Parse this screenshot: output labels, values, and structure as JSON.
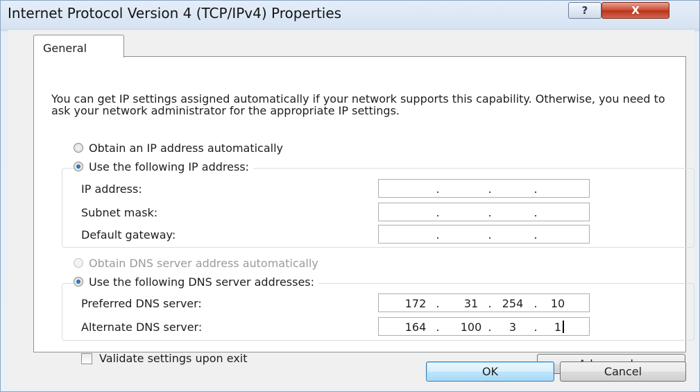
{
  "window": {
    "title": "Internet Protocol Version 4 (TCP/IPv4) Properties",
    "help_icon": "?",
    "close_icon": "X"
  },
  "tabs": [
    {
      "label": "General"
    }
  ],
  "intro_text": "You can get IP settings assigned automatically if your network supports this capability. Otherwise, you need to ask your network administrator for the appropriate IP settings.",
  "ip_section": {
    "obtain_auto_label": "Obtain an IP address automatically",
    "use_following_label": "Use the following IP address:",
    "selected": "use_following",
    "fields": [
      {
        "label": "IP address:",
        "octets": [
          "",
          "",
          "",
          ""
        ]
      },
      {
        "label": "Subnet mask:",
        "octets": [
          "",
          "",
          "",
          ""
        ]
      },
      {
        "label": "Default gateway:",
        "octets": [
          "",
          "",
          "",
          ""
        ]
      }
    ]
  },
  "dns_section": {
    "obtain_auto_label": "Obtain DNS server address automatically",
    "obtain_auto_disabled": true,
    "use_following_label": "Use the following DNS server addresses:",
    "selected": "use_following",
    "fields": [
      {
        "label": "Preferred DNS server:",
        "octets": [
          "172",
          "31",
          "254",
          "10"
        ]
      },
      {
        "label": "Alternate DNS server:",
        "octets": [
          "164",
          "100",
          "3",
          "1"
        ]
      }
    ]
  },
  "validate": {
    "label": "Validate settings upon exit",
    "checked": false
  },
  "buttons": {
    "advanced": "Advanced...",
    "ok": "OK",
    "cancel": "Cancel"
  },
  "ip_separator": "."
}
